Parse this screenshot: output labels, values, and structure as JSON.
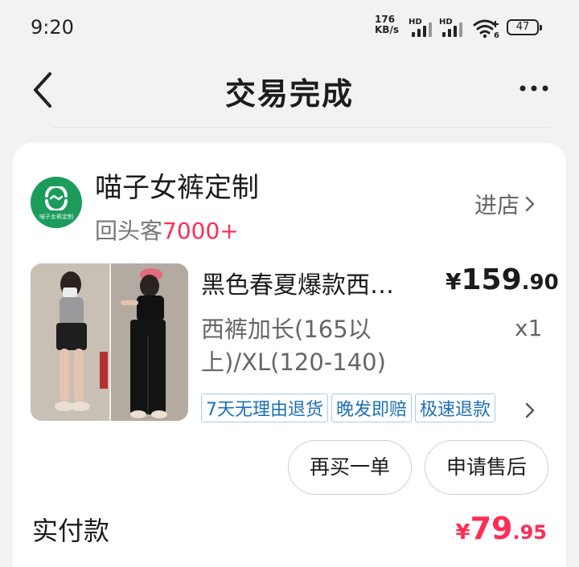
{
  "status_bar": {
    "time": "9:20",
    "net_speed_value": "176",
    "net_speed_unit": "KB/s",
    "signal_1_label": "HD",
    "signal_2_label": "HD",
    "battery_level": "47"
  },
  "nav": {
    "title": "交易完成",
    "back_icon": "back-chevron-icon",
    "more_icon": "more-dots-icon"
  },
  "shop": {
    "logo_text": "喵子女裤定制",
    "name": "喵子女裤定制",
    "repeat_label": "回头客",
    "repeat_count": "7000+",
    "enter_label": "进店"
  },
  "product": {
    "title": "黑色春夏爆款西…",
    "price_currency": "¥",
    "price_integer": "159",
    "price_decimal": ".90",
    "spec": "西裤加长(165以上)/XL(120-140)",
    "quantity": "x1",
    "tags": [
      "7天无理由退货",
      "晚发即赔",
      "极速退款"
    ]
  },
  "actions": {
    "buy_again": "再买一单",
    "after_sale": "申请售后"
  },
  "payment": {
    "label": "实付款",
    "currency": "¥",
    "integer": "79",
    "decimal": ".95"
  },
  "colors": {
    "accent_red": "#ff2d55",
    "tag_blue": "#1d70b8",
    "shop_green": "#1c9c5c"
  }
}
